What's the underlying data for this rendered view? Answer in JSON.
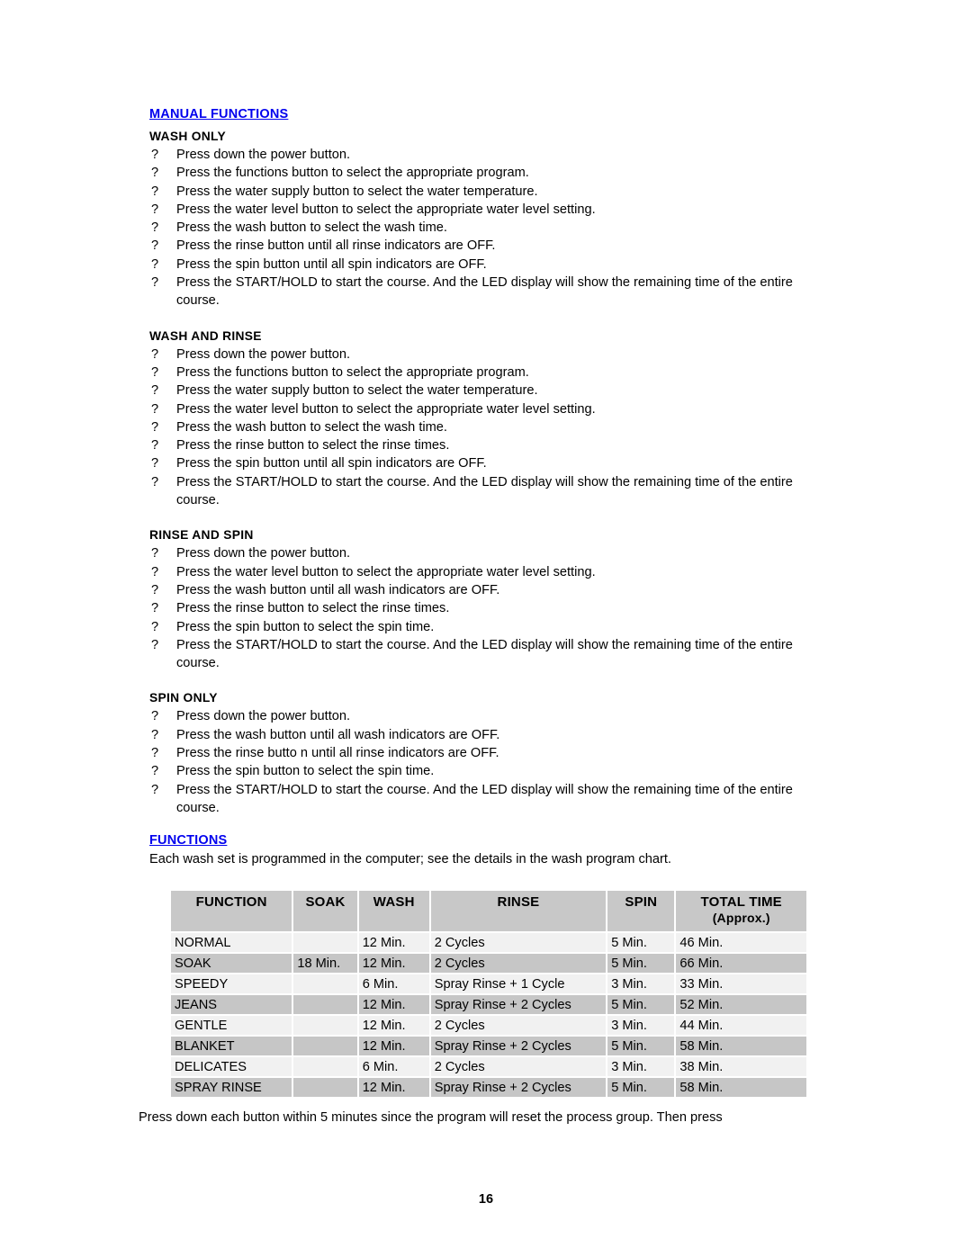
{
  "document": {
    "page_number": "16"
  },
  "manual_functions": {
    "heading": "MANUAL  FUNCTIONS",
    "bullet_glyph": "?",
    "sections": [
      {
        "title": "WASH ONLY",
        "steps": [
          "Press down the power button.",
          "Press the functions button to select the appropriate program.",
          "Press the water supply button to select the water temperature.",
          "Press the water level button to select the appropriate water level setting.",
          "Press the wash button to select the wash time.",
          "Press the rinse button until all rinse indicators are OFF.",
          "Press the spin button until all spin indicators are OFF.",
          "Press the START/HOLD to start the course. And the LED display will show the remaining time of the entire course."
        ]
      },
      {
        "title": "WASH AND RINSE",
        "steps": [
          "Press down the power button.",
          "Press the functions button to select the appropriate program.",
          "Press the water supply button to select the water temperature.",
          "Press the water level button to select the appropriate water level setting.",
          "Press the wash button to select the wash time.",
          "Press the rinse button to select the rinse times.",
          "Press the spin button until all spin indicators are OFF.",
          "Press the START/HOLD to start the course. And the LED display will show the remaining time of the entire course."
        ]
      },
      {
        "title": "RINSE AND SPIN",
        "steps": [
          "Press down the power button.",
          "Press the water level button to select the appropriate water level setting.",
          "Press the wash button until all wash indicators are OFF.",
          "Press the rinse button to select the rinse times.",
          "Press the spin button to select the spin time.",
          "Press the START/HOLD to start the course. And the LED display will show the remaining time of the entire course."
        ]
      },
      {
        "title": "SPIN ONLY",
        "steps": [
          "Press down the power button.",
          "Press the wash button until all wash indicators are OFF.",
          "Press the rinse butto n until all rinse indicators are OFF.",
          "Press the spin button to select the spin time.",
          "Press the START/HOLD to start the course. And the LED display will show the remaining time of the entire course."
        ]
      }
    ]
  },
  "functions_section": {
    "heading": "FUNCTIONS",
    "intro": "Each wash set is programmed in the computer; see the details in the wash program chart.",
    "footer_note": "Press down each button within 5 minutes since the program will reset the process group. Then press"
  },
  "chart_data": {
    "type": "table",
    "title": "FUNCTIONS wash program chart",
    "columns": [
      "FUNCTION",
      "SOAK",
      "WASH",
      "RINSE",
      "SPIN",
      "TOTAL TIME"
    ],
    "column_subheaders": {
      "TOTAL TIME": "(Approx.)"
    },
    "accent_color": "#0000ee",
    "header_bg": "#c8c8c8",
    "row_bg_odd": "#f1f1f1",
    "row_bg_even": "#c6c6c6",
    "rows": [
      {
        "function": "NORMAL",
        "soak": "",
        "wash": "12 Min.",
        "rinse": "2 Cycles",
        "spin": "5 Min.",
        "total": "46 Min.",
        "rinse_blue": false
      },
      {
        "function": "SOAK",
        "soak": "18 Min.",
        "wash": "12 Min.",
        "rinse": "2 Cycles",
        "spin": "5 Min.",
        "total": "66 Min.",
        "rinse_blue": false
      },
      {
        "function": "SPEEDY",
        "soak": "",
        "wash": "6 Min.",
        "rinse": "Spray Rinse + 1 Cycle",
        "spin": "3 Min.",
        "total": "33 Min.",
        "rinse_blue": false
      },
      {
        "function": "JEANS",
        "soak": "",
        "wash": "12 Min.",
        "rinse": "Spray Rinse + 2 Cycles",
        "spin": "5 Min.",
        "total": "52 Min.",
        "rinse_blue": false
      },
      {
        "function": "GENTLE",
        "soak": "",
        "wash": "12 Min.",
        "rinse": "2 Cycles",
        "spin": "3 Min.",
        "total": "44 Min.",
        "rinse_blue": false
      },
      {
        "function": "BLANKET",
        "soak": "",
        "wash": "12 Min.",
        "rinse": "Spray Rinse + 2 Cycles",
        "spin": "5 Min.",
        "total": "58 Min.",
        "rinse_blue": true
      },
      {
        "function": "DELICATES",
        "soak": "",
        "wash": "6 Min.",
        "rinse": "2 Cycles",
        "spin": "3 Min.",
        "total": "38 Min.",
        "rinse_blue": false
      },
      {
        "function": "SPRAY RINSE",
        "soak": "",
        "wash": "12 Min.",
        "rinse": "Spray Rinse + 2 Cycles",
        "spin": "5 Min.",
        "total": "58 Min.",
        "rinse_blue": false
      }
    ]
  }
}
